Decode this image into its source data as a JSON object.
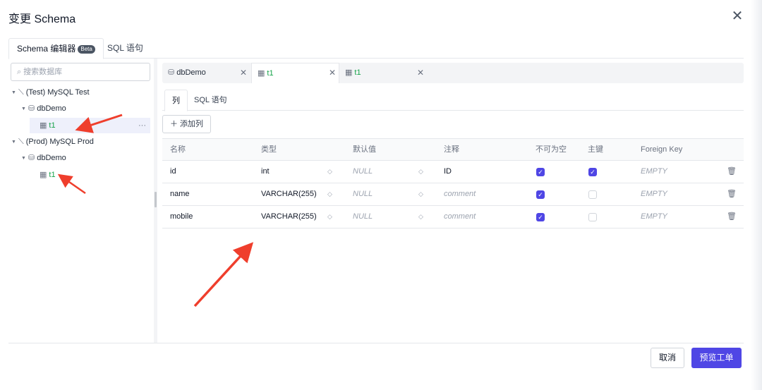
{
  "dialog": {
    "title": "变更 Schema",
    "close_glyph": "✕"
  },
  "top_tabs": [
    {
      "label": "Schema 编辑器",
      "badge": "Beta"
    },
    {
      "label": "SQL 语句"
    }
  ],
  "sidebar": {
    "search_placeholder": "搜索数据库",
    "tree": [
      {
        "label": "(Test) MySQL Test"
      },
      {
        "label": "dbDemo"
      },
      {
        "label": "t1",
        "more": "···"
      },
      {
        "label": "(Prod) MySQL Prod"
      },
      {
        "label": "dbDemo"
      },
      {
        "label": "t1"
      }
    ]
  },
  "editor_tabs": [
    {
      "label": "dbDemo"
    },
    {
      "label": "t1"
    },
    {
      "label": "t1"
    }
  ],
  "sub_tabs": [
    {
      "label": "列"
    },
    {
      "label": "SQL 语句"
    }
  ],
  "add_column_label": "＋ 添加列",
  "table": {
    "headers": [
      "名称",
      "类型",
      "默认值",
      "注释",
      "不可为空",
      "主键",
      "Foreign Key"
    ],
    "rows": [
      {
        "name": "id",
        "type": "int",
        "default": "NULL",
        "comment": "ID",
        "comment_placeholder": false,
        "not_null": true,
        "primary_key": true,
        "foreign_key": "EMPTY"
      },
      {
        "name": "name",
        "type": "VARCHAR(255)",
        "default": "NULL",
        "comment": "comment",
        "comment_placeholder": true,
        "not_null": true,
        "primary_key": false,
        "foreign_key": "EMPTY"
      },
      {
        "name": "mobile",
        "type": "VARCHAR(255)",
        "default": "NULL",
        "comment": "comment",
        "comment_placeholder": true,
        "not_null": true,
        "primary_key": false,
        "foreign_key": "EMPTY"
      }
    ]
  },
  "footer": {
    "cancel_label": "取消",
    "preview_label": "预览工单"
  },
  "colors": {
    "accent": "#4f46e5",
    "annotation_arrow": "#ef3e2c",
    "tree_table_green": "#16a34a"
  }
}
